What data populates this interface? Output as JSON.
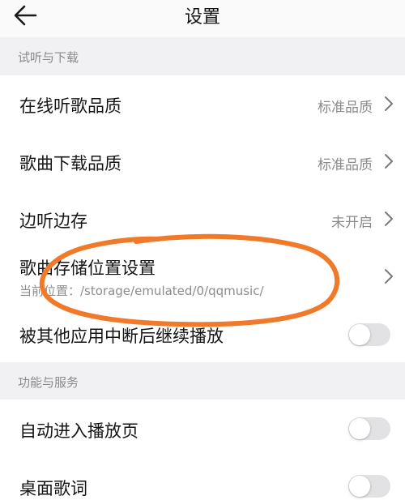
{
  "header": {
    "title": "设置",
    "back_icon": "arrow-left-icon"
  },
  "sections": [
    {
      "label": "试听与下载"
    },
    {
      "label": "功能与服务"
    }
  ],
  "rows": {
    "online_quality": {
      "label": "在线听歌品质",
      "value": "标准品质"
    },
    "download_quality": {
      "label": "歌曲下载品质",
      "value": "标准品质"
    },
    "cache_while_listening": {
      "label": "边听边存",
      "value": "未开启"
    },
    "storage_location": {
      "label": "歌曲存储位置设置",
      "sub": "当前位置：/storage/emulated/0/qqmusic/"
    },
    "continue_after_interrupt": {
      "label": "被其他应用中断后继续播放",
      "toggle_on": false
    },
    "auto_enter_player": {
      "label": "自动进入播放页",
      "toggle_on": false
    },
    "desktop_lyrics": {
      "label": "桌面歌词",
      "toggle_on": false
    }
  },
  "colors": {
    "annotation": "#f07a2a",
    "background": "#ffffff",
    "section_bg": "#f1f1f3",
    "secondary_text": "#8a8a8a",
    "toggle_off": "#e2e2e4"
  }
}
